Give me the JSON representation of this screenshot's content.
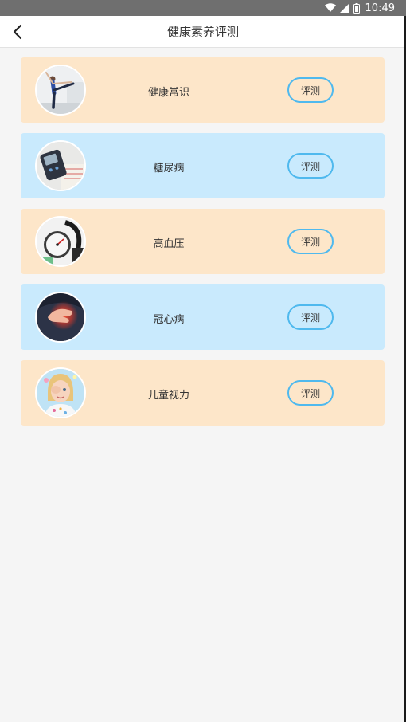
{
  "status_bar": {
    "time": "10:49",
    "icons": [
      "wifi-icon",
      "signal-icon",
      "battery-icon"
    ]
  },
  "header": {
    "title": "健康素养评测",
    "back_icon": "chevron-left-icon"
  },
  "items": [
    {
      "label": "健康常识",
      "button": "评测",
      "image": "yoga-woman",
      "bg": "#fde6c9"
    },
    {
      "label": "糖尿病",
      "button": "评测",
      "image": "glucose-meter",
      "bg": "#c9eafd"
    },
    {
      "label": "高血压",
      "button": "评测",
      "image": "blood-pressure-gauge",
      "bg": "#fde6c9"
    },
    {
      "label": "冠心病",
      "button": "评测",
      "image": "hand-on-chest",
      "bg": "#c9eafd"
    },
    {
      "label": "儿童视力",
      "button": "评测",
      "image": "child-covering-eye",
      "bg": "#fde6c9"
    }
  ],
  "colors": {
    "accent": "#4fb9ee",
    "peach": "#fde6c9",
    "light_blue": "#c9eafd"
  }
}
